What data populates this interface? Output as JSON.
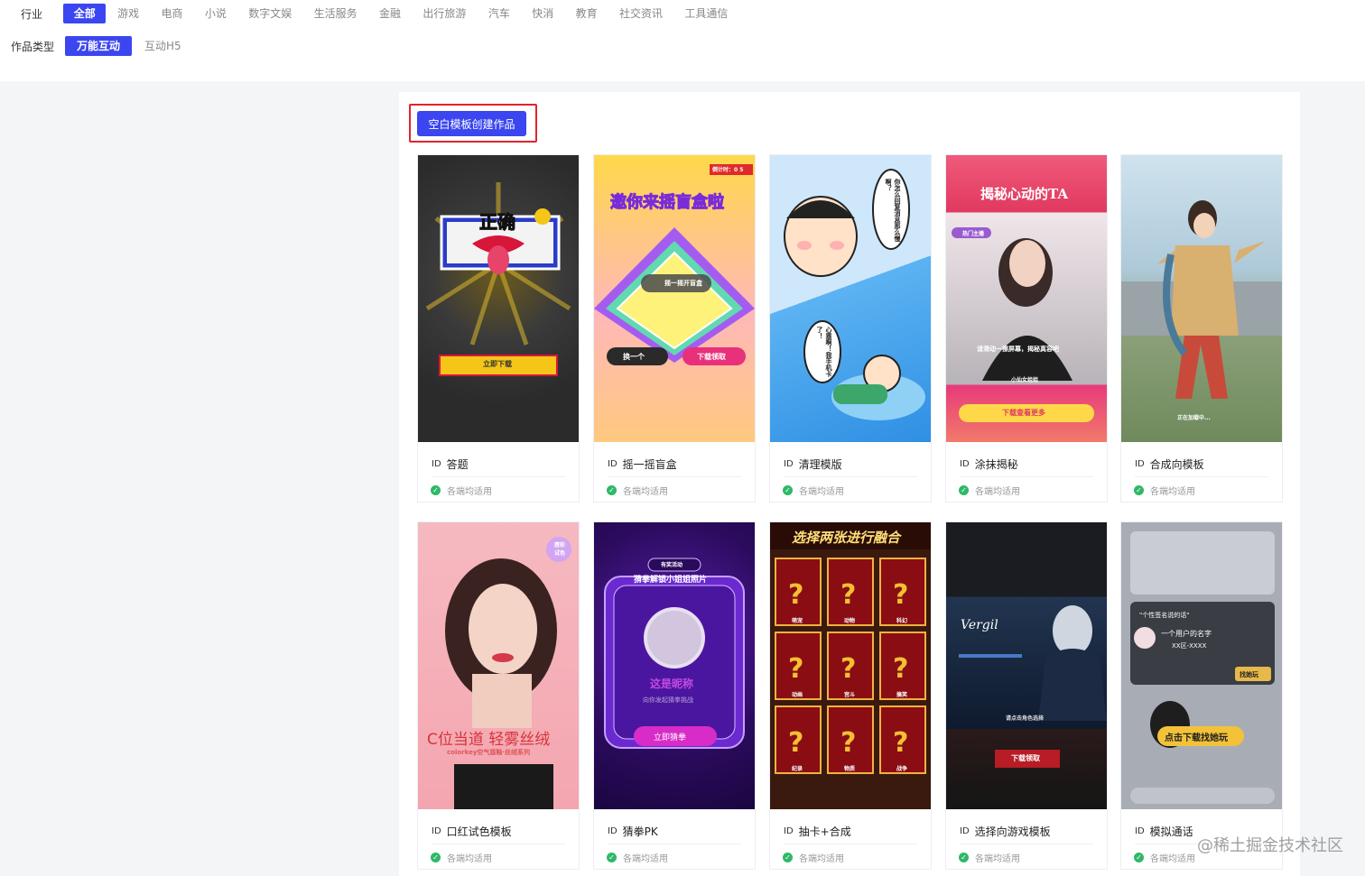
{
  "filters": {
    "industry": {
      "label": "行业",
      "items": [
        "全部",
        "游戏",
        "电商",
        "小说",
        "数字文娱",
        "生活服务",
        "金融",
        "出行旅游",
        "汽车",
        "快消",
        "教育",
        "社交资讯",
        "工具通信"
      ],
      "active_index": 0
    },
    "work_type": {
      "label": "作品类型",
      "items": [
        "万能互动",
        "互动H5"
      ],
      "active_index": 0
    }
  },
  "create_button": "空白模板创建作品",
  "id_label": "ID",
  "compat_text": "各端均适用",
  "templates": [
    {
      "name": "答题",
      "thumb_text": "正确",
      "thumb_button": "立即下载"
    },
    {
      "name": "摇一摇盲盒",
      "thumb_text": "邀你来摇盲盒啦",
      "thumb_badge": "倒计时：0 5",
      "thumb_button": "下载领取",
      "thumb_button2": "换一个",
      "thumb_shake": "摇一摇开盲盒"
    },
    {
      "name": "清理模版",
      "thumb_text": "你怎么回复消息那么慢啊？",
      "thumb_text2": "心塞啊！我手机卡了！"
    },
    {
      "name": "涂抹揭秘",
      "thumb_text": "揭秘心动的TA",
      "thumb_badge": "热门主播",
      "thumb_caption": "请滑动一擦屏幕，揭秘真容吧",
      "thumb_caption2": "小仙女姐姐",
      "thumb_button": "下载查看更多"
    },
    {
      "name": "合成向模板",
      "thumb_caption": "正在加载中..."
    },
    {
      "name": "口红试色模板",
      "thumb_text": "C位当道 轻雾丝绒",
      "thumb_caption": "colorkey空气唇釉·丝绒系列",
      "thumb_badge": "唇彩 试色"
    },
    {
      "name": "猜拳PK",
      "thumb_badge": "有奖活动",
      "thumb_text": "猜拳解锁小姐姐照片",
      "thumb_text2": "这是昵称",
      "thumb_caption": "向你发起猜拳挑战",
      "thumb_button": "立即猜拳"
    },
    {
      "name": "抽卡+合成",
      "thumb_text": "选择两张进行融合",
      "cards": [
        "萌宠",
        "动物",
        "科幻",
        "动画",
        "宫斗",
        "搞笑",
        "纪录",
        "物质",
        "战争"
      ]
    },
    {
      "name": "选择向游戏模板",
      "thumb_text": "Vergil",
      "thumb_caption": "请点击角色选择",
      "thumb_button": "下载领取"
    },
    {
      "name": "模拟通话",
      "thumb_text": "\"个性签名说的话\"",
      "thumb_text2": "一个用户的名字",
      "thumb_caption": "XX区-XXXX",
      "thumb_button": "找她玩",
      "thumb_button2": "点击下载找她玩"
    }
  ],
  "watermark": "@稀土掘金技术社区"
}
